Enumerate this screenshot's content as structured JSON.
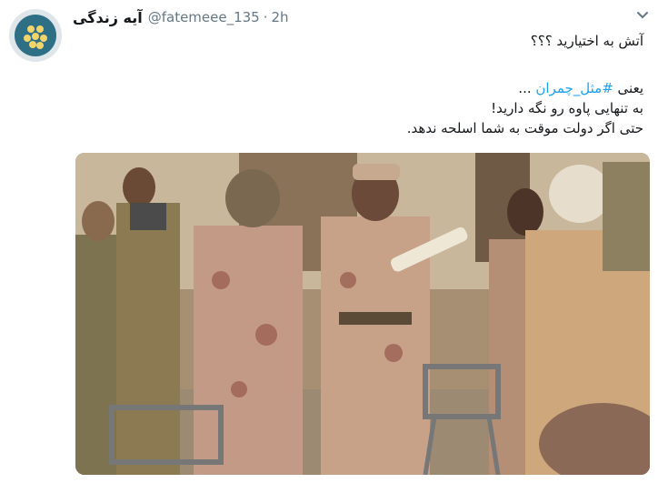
{
  "tweet": {
    "display_name": "آیه زندگی",
    "handle": "@fatemeee_135",
    "separator": "·",
    "time": "2h",
    "line1": "آتش به اختیارید ؟؟؟",
    "line2_prefix": "یعنی ",
    "hashtag": "#مثل_چمران",
    "line2_suffix": " ...",
    "line3": "به تنهایی پاوه رو نگه دارید!",
    "line4": "حتی اگر دولت موقت به شما اسلحه ندهد."
  },
  "icons": {
    "menu": "chevron-down-icon"
  },
  "colors": {
    "link": "#1da1f2",
    "secondary_text": "#657786",
    "text": "#14171a"
  }
}
